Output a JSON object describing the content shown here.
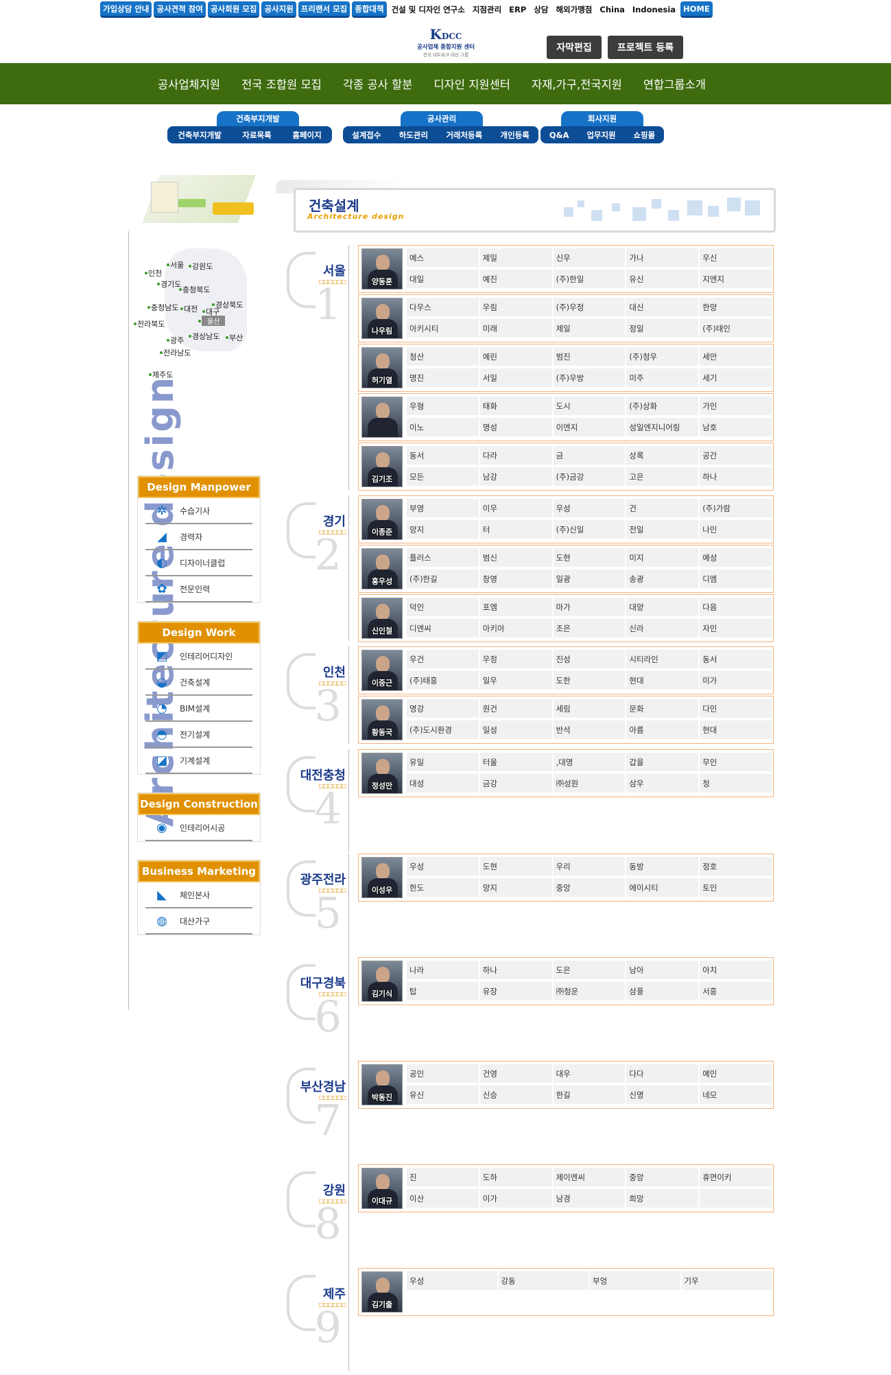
{
  "top_nav": [
    {
      "label": "가입상담 안내",
      "style": "blue"
    },
    {
      "label": "공사견적 참여",
      "style": "blue"
    },
    {
      "label": "공사회원 모집",
      "style": "blue"
    },
    {
      "label": "공사지원",
      "style": "blue"
    },
    {
      "label": "프리랜서 모집",
      "style": "blue"
    },
    {
      "label": "종합대책",
      "style": "blue"
    },
    {
      "label": "건설 및 디자인 연구소",
      "style": "plain"
    },
    {
      "label": "지점관리",
      "style": "plain"
    },
    {
      "label": "ERP",
      "style": "plain"
    },
    {
      "label": "상담",
      "style": "plain"
    },
    {
      "label": "해외가맹점",
      "style": "plain"
    },
    {
      "label": "China",
      "style": "plain"
    },
    {
      "label": "Indonesia",
      "style": "plain"
    },
    {
      "label": "HOME",
      "style": "blue"
    }
  ],
  "logo": {
    "mark": "K",
    "mark_rest": "DCC",
    "line1": "공사업체 종합지원 센터",
    "line2": "전국 네트워크 대산 그룹"
  },
  "buttons": {
    "subtitle_edit": "자막편집",
    "project_register": "프로젝트 등록"
  },
  "main_menu": [
    "공사업체지원",
    "전국 조합원 모집",
    "각종 공사 할분",
    "디자인 지원센터",
    "자재,가구,전국지원",
    "연합그룹소개"
  ],
  "sub_menu": [
    {
      "title": "건축부지개발",
      "items": [
        "건축부지개발",
        "자료목록",
        "홈페이지"
      ]
    },
    {
      "title": "공사관리",
      "items": [
        "설계접수",
        "하도관리",
        "거래처등록",
        "개인등록"
      ]
    },
    {
      "title": "회사지원",
      "items": [
        "Q&A",
        "업무지원",
        "쇼핑몰"
      ]
    }
  ],
  "vertical_title": "Architecture design",
  "map_regions": [
    "서울",
    "강원도",
    "인천",
    "경기도",
    "충청북도",
    "충청남도",
    "대전",
    "경상북도",
    "전라북도",
    "대구",
    "울산",
    "광주",
    "경상남도",
    "부산",
    "전라남도",
    "제주도"
  ],
  "side_boxes": [
    {
      "title": "Design Manpower",
      "items": [
        "수습기사",
        "경력자",
        "디자이너클럽",
        "전문인력"
      ]
    },
    {
      "title": "Design Work",
      "items": [
        "인테리어디자인",
        "건축설계",
        "BIM설계",
        "전기설계",
        "기계설계"
      ]
    },
    {
      "title": "Design Construction",
      "items": [
        "인테리어시공"
      ]
    },
    {
      "title": "Business Marketing",
      "items": [
        "체인본사",
        "대산가구"
      ]
    }
  ],
  "page_header": {
    "title": "건축설계",
    "subtitle": "Architecture design"
  },
  "regions": [
    {
      "name": "서울",
      "number": "1",
      "cards": [
        {
          "person": "양동훈",
          "rows": [
            [
              "예스",
              "제일",
              "신우",
              "가나",
              "우신"
            ],
            [
              "대일",
              "예진",
              "(주)한일",
              "유신",
              "지엔지"
            ]
          ]
        },
        {
          "person": "나우림",
          "rows": [
            [
              "다우스",
              "우림",
              "(주)우정",
              "대신",
              "한양"
            ],
            [
              "아키시티",
              "미래",
              "제일",
              "정일",
              "(주)태인"
            ]
          ]
        },
        {
          "person": "허기열",
          "rows": [
            [
              "청산",
              "예린",
              "범진",
              "(주)청우",
              "세안"
            ],
            [
              "명진",
              "서일",
              "(주)우방",
              "미주",
              "세기"
            ]
          ]
        },
        {
          "person": "",
          "rows": [
            [
              "우형",
              "태화",
              "도시",
              "(주)상화",
              "가인"
            ],
            [
              "이노",
              "명성",
              "이엔지",
              "성일엔지니어링",
              "남호"
            ]
          ]
        },
        {
          "person": "김기조",
          "rows": [
            [
              "동서",
              "다라",
              "금",
              "상록",
              "공간"
            ],
            [
              "모든",
              "남강",
              "(주)금강",
              "고은",
              "하나"
            ]
          ]
        }
      ]
    },
    {
      "name": "경기",
      "number": "2",
      "cards": [
        {
          "person": "이종준",
          "rows": [
            [
              "부영",
              "이우",
              "우성",
              "건",
              "(주)가람"
            ],
            [
              "양지",
              "터",
              "(주)신일",
              "전일",
              "나인"
            ]
          ]
        },
        {
          "person": "홍우성",
          "rows": [
            [
              "플러스",
              "범신",
              "도현",
              "미지",
              "예성"
            ],
            [
              "(주)한길",
              "창영",
              "일광",
              "송광",
              "디엠"
            ]
          ]
        },
        {
          "person": "신인철",
          "rows": [
            [
              "덕인",
              "포엠",
              "마가",
              "대양",
              "다음"
            ],
            [
              "디엔씨",
              "아키아",
              "조은",
              "신라",
              "자인"
            ]
          ]
        }
      ]
    },
    {
      "name": "인천",
      "number": "3",
      "cards": [
        {
          "person": "이중근",
          "rows": [
            [
              "우건",
              "우정",
              "진성",
              "시티라인",
              "동서"
            ],
            [
              "(주)태흥",
              "일우",
              "도한",
              "현대",
              "미가"
            ]
          ]
        },
        {
          "person": "황동국",
          "rows": [
            [
              "명강",
              "원건",
              "세림",
              "문화",
              "다인"
            ],
            [
              "(주)도시환경",
              "일성",
              "반석",
              "아름",
              "현대"
            ]
          ]
        }
      ]
    },
    {
      "name": "대전충청",
      "number": "4",
      "cards": [
        {
          "person": "정성만",
          "rows": [
            [
              "유일",
              "터울",
              ",대명",
              "갑을",
              "무인"
            ],
            [
              "대성",
              "금강",
              "㈜성원",
              "삼우",
              "청"
            ]
          ]
        }
      ]
    },
    {
      "name": "광주전라",
      "number": "5",
      "cards": [
        {
          "person": "이성우",
          "rows": [
            [
              "우성",
              "도현",
              "우리",
              "동방",
              "정호"
            ],
            [
              "한도",
              "양지",
              "중앙",
              "에이시티",
              "토인"
            ]
          ]
        }
      ]
    },
    {
      "name": "대구경북",
      "number": "6",
      "cards": [
        {
          "person": "김기식",
          "rows": [
            [
              "나라",
              "하나",
              "도은",
              "남아",
              "아치"
            ],
            [
              "탑",
              "유장",
              "㈜청운",
              "삼풍",
              "서흥"
            ]
          ]
        }
      ]
    },
    {
      "name": "부산경남",
      "number": "7",
      "cards": [
        {
          "person": "박동진",
          "rows": [
            [
              "공인",
              "건영",
              "대우",
              "다다",
              "예인"
            ],
            [
              "유신",
              "신승",
              "한길",
              "신명",
              "네모"
            ]
          ]
        }
      ]
    },
    {
      "name": "강원",
      "number": "8",
      "cards": [
        {
          "person": "이대규",
          "rows": [
            [
              "진",
              "도하",
              "제이엔씨",
              "중앙",
              "휴면이키"
            ],
            [
              "이산",
              "이가",
              "남경",
              "희망",
              ""
            ]
          ]
        }
      ]
    },
    {
      "name": "제주",
      "number": "9",
      "cards": [
        {
          "person": "김기출",
          "rows": [
            [
              "우성",
              "강동",
              "부엉",
              "기우"
            ]
          ]
        }
      ]
    }
  ]
}
